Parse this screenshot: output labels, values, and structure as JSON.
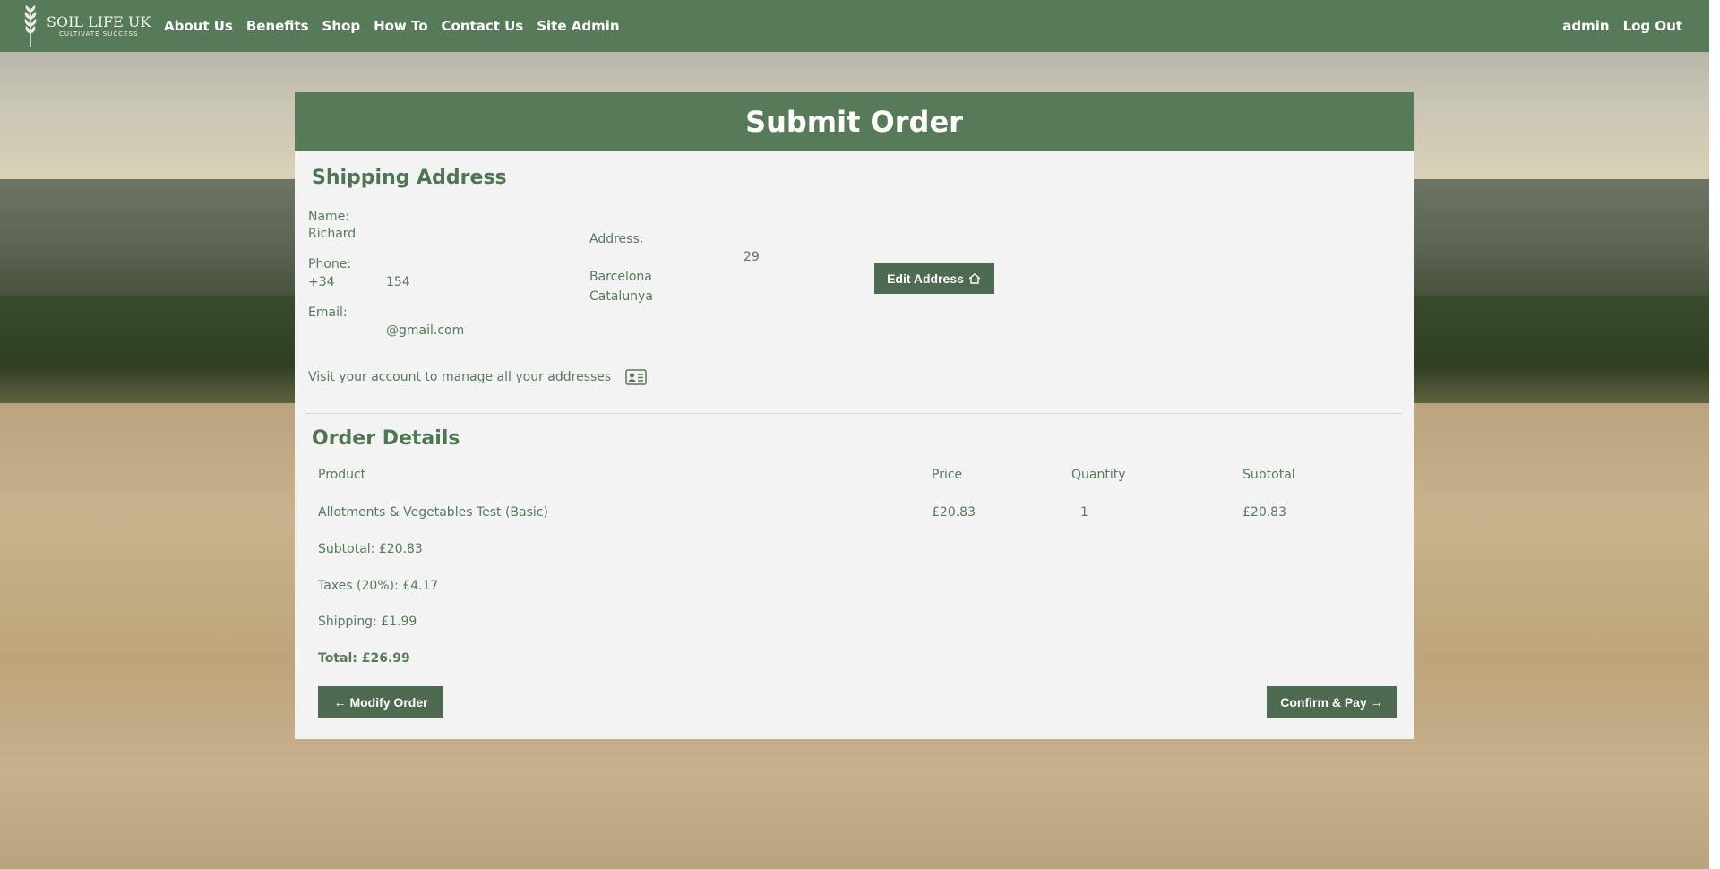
{
  "nav": {
    "logo_title": "SOIL LIFE UK",
    "logo_subtitle": "CULTIVATE SUCCESS",
    "links": [
      "About Us",
      "Benefits",
      "Shop",
      "How To",
      "Contact Us",
      "Site Admin"
    ],
    "user": "admin",
    "logout": "Log Out"
  },
  "page": {
    "title": "Submit Order"
  },
  "shipping": {
    "title": "Shipping Address",
    "name_label": "Name:",
    "name_value": "Richard",
    "phone_label": "Phone:",
    "phone_prefix": "+34",
    "phone_suffix": "154",
    "email_label": "Email:",
    "email_value": "@gmail.com",
    "address_label": "Address:",
    "address_number": "29",
    "address_city": "Barcelona",
    "address_region": "Catalunya",
    "edit_button": "Edit Address",
    "manage_text": "Visit your account to manage all your addresses"
  },
  "order": {
    "title": "Order Details",
    "columns": {
      "product": "Product",
      "price": "Price",
      "quantity": "Quantity",
      "subtotal": "Subtotal"
    },
    "rows": [
      {
        "product": "Allotments & Vegetables Test (Basic)",
        "price": "£20.83",
        "quantity": "1",
        "subtotal": "£20.83"
      }
    ],
    "subtotal": "Subtotal: £20.83",
    "taxes": "Taxes (20%): £4.17",
    "shipping": "Shipping: £1.99",
    "total": "Total: £26.99",
    "modify_button": "Modify Order",
    "confirm_button": "Confirm & Pay"
  },
  "colors": {
    "brand_green": "#577b59",
    "button_green": "#4e6a50",
    "text_green": "#557b5a",
    "card_bg": "#f3f3f3"
  }
}
